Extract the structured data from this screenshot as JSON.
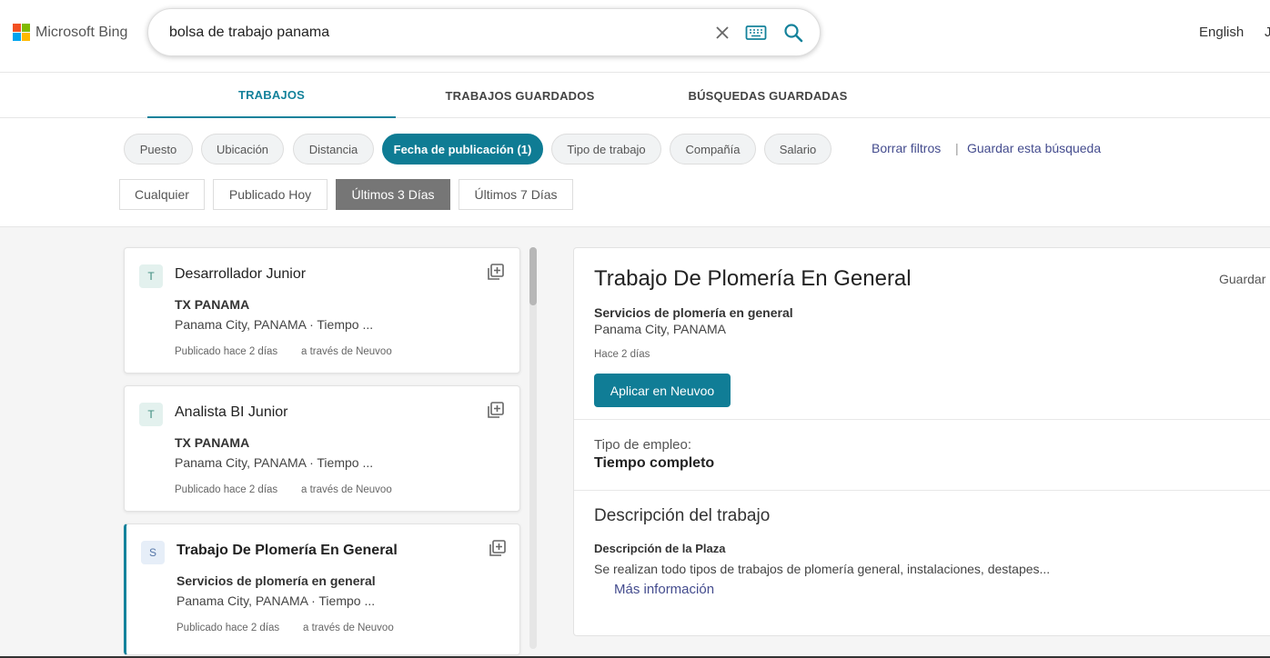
{
  "header": {
    "logo_text": "Microsoft Bing",
    "search_query": "bolsa de trabajo panama",
    "language": "English",
    "truncated_text": "J"
  },
  "tabs": [
    {
      "label": "TRABAJOS",
      "active": true
    },
    {
      "label": "TRABAJOS GUARDADOS",
      "active": false
    },
    {
      "label": "BÚSQUEDAS GUARDADAS",
      "active": false
    }
  ],
  "filters": {
    "pills": [
      {
        "label": "Puesto",
        "active": false
      },
      {
        "label": "Ubicación",
        "active": false
      },
      {
        "label": "Distancia",
        "active": false
      },
      {
        "label": "Fecha de publicación (1)",
        "active": true
      },
      {
        "label": "Tipo de trabajo",
        "active": false
      },
      {
        "label": "Compañía",
        "active": false
      },
      {
        "label": "Salario",
        "active": false
      }
    ],
    "clear_link": "Borrar filtros",
    "separator": "|",
    "save_search_link": "Guardar esta búsqueda",
    "date_options": [
      {
        "label": "Cualquier",
        "active": false
      },
      {
        "label": "Publicado Hoy",
        "active": false
      },
      {
        "label": "Últimos 3 Días",
        "active": true
      },
      {
        "label": "Últimos 7 Días",
        "active": false
      }
    ]
  },
  "jobs": [
    {
      "avatar": "T",
      "title": "Desarrollador Junior",
      "company": "TX PANAMA",
      "location": "Panama City, PANAMA · Tiempo ...",
      "posted": "Publicado hace 2 días",
      "via": "a través de Neuvoo",
      "selected": false
    },
    {
      "avatar": "T",
      "title": "Analista BI Junior",
      "company": "TX PANAMA",
      "location": "Panama City, PANAMA · Tiempo ...",
      "posted": "Publicado hace 2 días",
      "via": "a través de Neuvoo",
      "selected": false
    },
    {
      "avatar": "S",
      "title": "Trabajo De Plomería En General",
      "company": "Servicios de plomería en general",
      "location": "Panama City, PANAMA · Tiempo ...",
      "posted": "Publicado hace 2 días",
      "via": "a través de Neuvoo",
      "selected": true
    }
  ],
  "detail": {
    "title": "Trabajo De Plomería En General",
    "save_label": "Guardar",
    "company": "Servicios de plomería en general",
    "location": "Panama City, PANAMA",
    "posted_ago": "Hace 2 días",
    "apply_label": "Aplicar en Neuvoo",
    "employment_label": "Tipo de empleo:",
    "employment_value": "Tiempo completo",
    "description_heading": "Descripción del trabajo",
    "description_subheading": "Descripción de la Plaza",
    "description_text": "Se realizan todo tipos de trabajos de plomería general, instalaciones, destapes...",
    "more_info": "Más información"
  },
  "colors": {
    "accent": "#14829b",
    "link": "#444c8e",
    "ms_red": "#f25022",
    "ms_green": "#7fba00",
    "ms_blue": "#00a4ef",
    "ms_yellow": "#ffb900"
  }
}
